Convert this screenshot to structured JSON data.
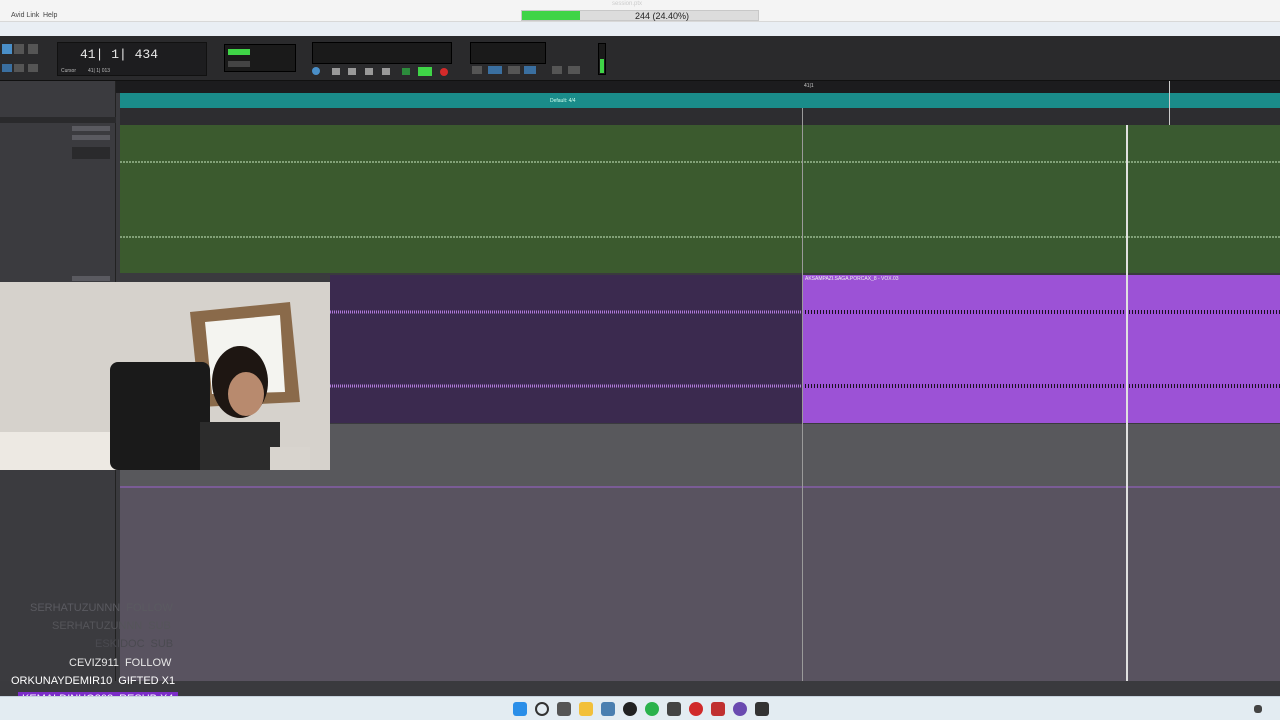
{
  "menubar": {
    "items": [
      "Avid Link",
      "Help"
    ],
    "session_label": "session.ptx"
  },
  "progress": {
    "text": "244 (24.40%)",
    "percent": 24.4
  },
  "counter": {
    "main": "41| 1| 434",
    "cursor_label": "Cursor",
    "cursor_value": "41| 1| 013"
  },
  "markers": {
    "default_label": "Default: 4/4",
    "playhead_marker": "41|1"
  },
  "tracks": {
    "track2_clip_name": "AKSAMPAZI.SAGA.PORCAX_8 - VOX.03"
  },
  "chat": [
    {
      "name": "SERHATUZUNNN",
      "action": "FOLLOW",
      "faded": true
    },
    {
      "name": "SERHATUZUNNN",
      "action": "SUB",
      "faded": true
    },
    {
      "name": "ESKIDOC",
      "action": "SUB",
      "faded": true
    },
    {
      "name": "CEVIZ911",
      "action": "FOLLOW",
      "faded": false
    },
    {
      "name": "ORKUNAYDEMIR10",
      "action": "GIFTED X1",
      "faded": false
    },
    {
      "name": "KEMALDINHO808",
      "action": "RESUB X4",
      "highlight": true
    }
  ],
  "taskbar_icons": [
    "windows-start",
    "search",
    "task-view",
    "file-explorer",
    "snipping-tool",
    "itunes",
    "whatsapp",
    "capture",
    "netflix",
    "chrome",
    "gallery",
    "pro-tools",
    "ua-connect"
  ],
  "colors": {
    "green_track": "#3b5a2e",
    "purple_clip": "#9c52d6",
    "purple_dark": "#3b2a4f",
    "marker_teal": "#1a8c8a",
    "chat_highlight": "#7b2cc8",
    "progress_green": "#3fd447"
  }
}
